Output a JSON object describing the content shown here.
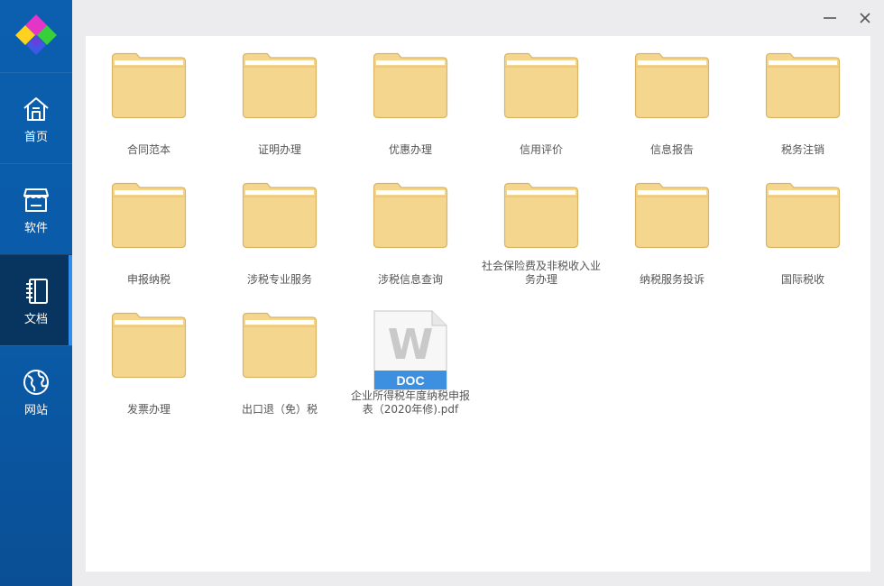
{
  "sidebar": {
    "items": [
      {
        "label": "首页",
        "icon": "home-icon"
      },
      {
        "label": "软件",
        "icon": "store-icon"
      },
      {
        "label": "文档",
        "icon": "notebook-icon",
        "active": true
      },
      {
        "label": "网站",
        "icon": "globe-icon"
      }
    ]
  },
  "window": {
    "minimize_icon": "minimize-icon",
    "close_icon": "close-icon"
  },
  "files": [
    {
      "name": "合同范本",
      "type": "folder"
    },
    {
      "name": "证明办理",
      "type": "folder"
    },
    {
      "name": "优惠办理",
      "type": "folder"
    },
    {
      "name": "信用评价",
      "type": "folder"
    },
    {
      "name": "信息报告",
      "type": "folder"
    },
    {
      "name": "税务注销",
      "type": "folder"
    },
    {
      "name": "申报纳税",
      "type": "folder"
    },
    {
      "name": "涉税专业服务",
      "type": "folder"
    },
    {
      "name": "涉税信息查询",
      "type": "folder"
    },
    {
      "name": "社会保险费及非税收入业务办理",
      "type": "folder"
    },
    {
      "name": "纳税服务投诉",
      "type": "folder"
    },
    {
      "name": "国际税收",
      "type": "folder"
    },
    {
      "name": "发票办理",
      "type": "folder"
    },
    {
      "name": "出口退（免）税",
      "type": "folder"
    },
    {
      "name": "企业所得税年度纳税申报表（2020年修).pdf",
      "type": "doc",
      "badge": "DOC"
    }
  ],
  "colors": {
    "sidebar": "#0b5fae",
    "sidebar_active": "#07355f",
    "active_indicator": "#2f8df0",
    "folder_fill": "#f5d68e",
    "folder_stroke": "#d9b463",
    "doc_badge": "#3d8fdf"
  }
}
